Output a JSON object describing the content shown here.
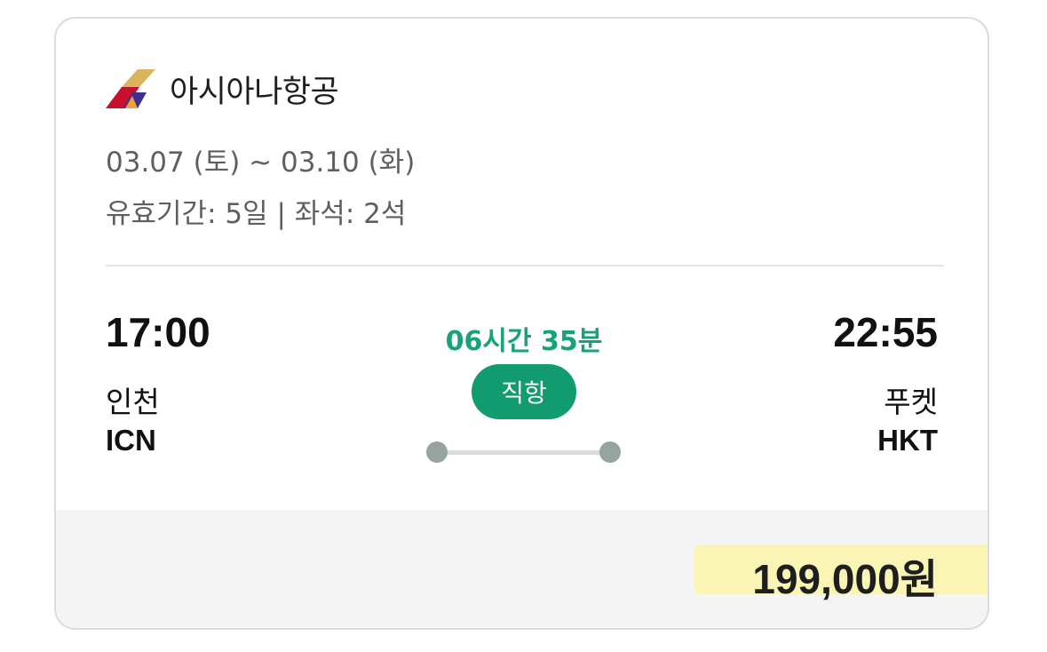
{
  "airline": {
    "name": "아시아나항공",
    "logo_icon": "asiana-tail-logo-icon",
    "logo_colors": [
      "#d9b45a",
      "#c8102e",
      "#3e2f8f"
    ]
  },
  "trip": {
    "dates": "03.07 (토) ~ 03.10 (화)",
    "validity": "유효기간: 5일 | 좌석: 2석"
  },
  "flight": {
    "departure": {
      "time": "17:00",
      "city": "인천",
      "code": "ICN"
    },
    "arrival": {
      "time": "22:55",
      "city": "푸켓",
      "code": "HKT"
    },
    "duration": "06시간 35분",
    "type_label": "직항"
  },
  "price": {
    "amount": "199,000원"
  },
  "colors": {
    "accent_green": "#17a27a",
    "badge_green": "#119b6e",
    "highlight_yellow": "#fbf5b5"
  }
}
